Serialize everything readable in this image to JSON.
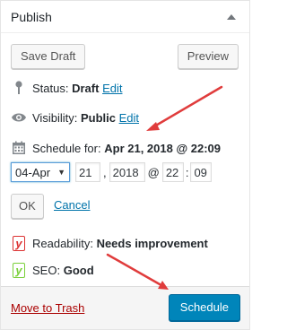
{
  "header": {
    "title": "Publish",
    "toggle_icon": "triangle-up-icon"
  },
  "actions": {
    "save_draft": "Save Draft",
    "preview": "Preview"
  },
  "status": {
    "label": "Status:",
    "value": "Draft",
    "edit": "Edit"
  },
  "visibility": {
    "label": "Visibility:",
    "value": "Public",
    "edit": "Edit"
  },
  "schedule": {
    "label": "Schedule for:",
    "value": "Apr 21, 2018 @ 22:09"
  },
  "date_fields": {
    "month": "04-Apr",
    "day": "21",
    "year": "2018",
    "at": "@",
    "hour": "22",
    "colon": ":",
    "minute": "09",
    "ok": "OK",
    "cancel": "Cancel"
  },
  "seo": {
    "readability_label": "Readability:",
    "readability_value": "Needs improvement",
    "seo_label": "SEO:",
    "seo_value": "Good",
    "yoast_glyph": "y"
  },
  "footer": {
    "trash": "Move to Trash",
    "schedule": "Schedule"
  },
  "colors": {
    "accent": "#0085ba",
    "link": "#0073aa",
    "trash": "#a00",
    "arrow": "#e03c3c",
    "seo_bad": "#dc3232",
    "seo_good": "#7ad03a"
  }
}
